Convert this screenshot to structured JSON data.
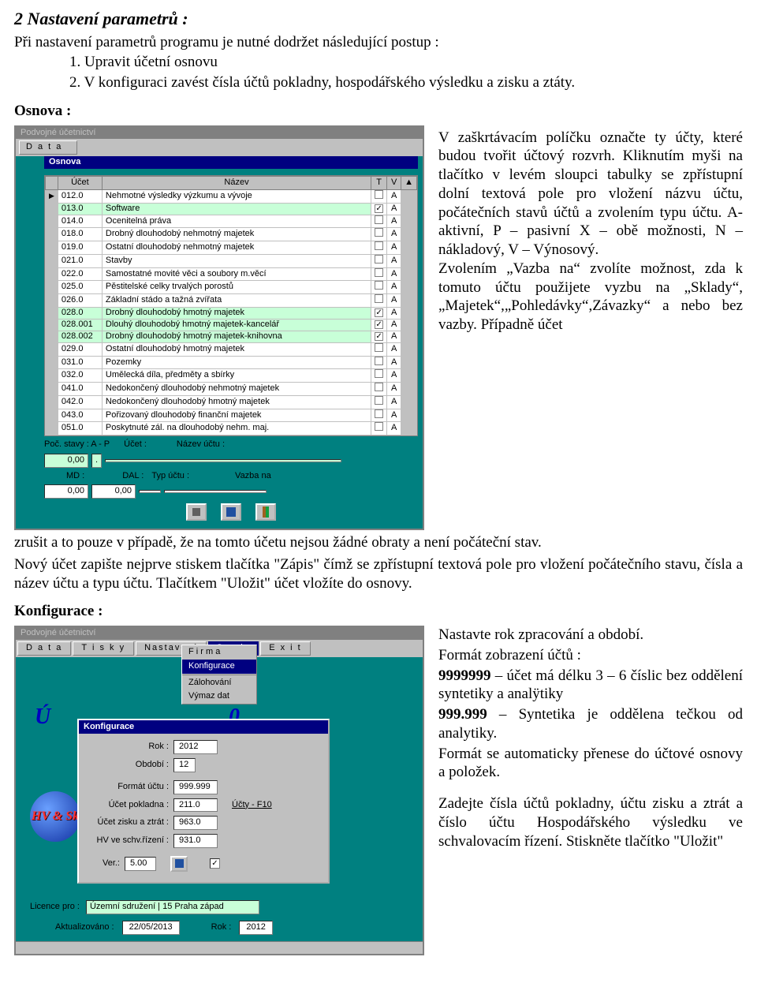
{
  "heading": "2   Nastavení parametrů :",
  "intro": "Při nastavení parametrů programu je nutné dodržet následující postup :",
  "step1": "1.  Upravit účetní osnovu",
  "step2": "2.  V konfiguraci zavést čísla účtů pokladny, hospodářského výsledku a zisku a ztáty.",
  "osnova_label": "Osnova :",
  "osnova_text": "V zaškrtávacím políčku označte ty účty, které budou tvořit účtový rozvrh. Kliknutím myši na tlačítko v levém sloupci tabulky se zpřístupní dolní textová pole pro vložení názvu účtu, počátečních stavů účtů a zvolením typu účtu. A- aktivní, P – pasivní X – obě možnosti, N – nákladový, V – Výnosový.",
  "osnova_text2": "Zvolením „Vazba na“ zvolíte možnost, zda k tomuto účtu použijete vyzbu na „Sklady“, „Majetek“,„Pohledávky“,Závazky“ a nebo bez vazby. Případně účet",
  "after_osnova1": "zrušit a to pouze v případě, že na tomto účetu nejsou žádné obraty a není počáteční stav.",
  "after_osnova2": "Nový účet zapište nejprve stiskem tlačítka \"Zápis\" čímž se zpřístupní textová pole pro vložení počátečního stavu, čísla a název účtu a typu účtu. Tlačítkem \"Uložit\" účet vložíte do osnovy.",
  "konf_label": "Konfigurace :",
  "konf_p1": "Nastavte rok zpracování a období.",
  "konf_p2": "Formát zobrazení účtů :",
  "konf_p3a": "9999999",
  "konf_p3b": " – účet má délku 3 – 6 číslic bez oddělení syntetiky a analÿtiky",
  "konf_p4a": "999.999",
  "konf_p4b": " – Syntetika je oddělena tečkou od analytiky.",
  "konf_p5": "Formát se automaticky přenese do účtové osnovy a položek.",
  "konf_p6": "Zadejte čísla účtů pokladny, účtu zisku a ztrát a číslo účtu Hospodářského výsledku ve schvalovacím řízení. Stiskněte tlačítko \"Uložit\"",
  "app1": {
    "title": "Podvojné účetnictví",
    "menu_data": "D a t a",
    "panel_title": "Osnova",
    "headers": {
      "ucet": "Účet",
      "nazev": "Název",
      "t": "T",
      "v": "V"
    },
    "rows": [
      {
        "u": "012.0",
        "n": "Nehmotné výsledky výzkumu a vývoje",
        "c": false,
        "t": "A",
        "sel": false
      },
      {
        "u": "013.0",
        "n": "Software",
        "c": true,
        "t": "A",
        "sel": true
      },
      {
        "u": "014.0",
        "n": "Ocenitelná práva",
        "c": false,
        "t": "A",
        "sel": false
      },
      {
        "u": "018.0",
        "n": "Drobný dlouhodobý nehmotný majetek",
        "c": false,
        "t": "A",
        "sel": false
      },
      {
        "u": "019.0",
        "n": "Ostatní dlouhodobý nehmotný majetek",
        "c": false,
        "t": "A",
        "sel": false
      },
      {
        "u": "021.0",
        "n": "Stavby",
        "c": false,
        "t": "A",
        "sel": false
      },
      {
        "u": "022.0",
        "n": "Samostatné movité věci a soubory m.věcí",
        "c": false,
        "t": "A",
        "sel": false
      },
      {
        "u": "025.0",
        "n": "Pěstitelské celky trvalých porostů",
        "c": false,
        "t": "A",
        "sel": false
      },
      {
        "u": "026.0",
        "n": "Základní stádo a tažná zvířata",
        "c": false,
        "t": "A",
        "sel": false
      },
      {
        "u": "028.0",
        "n": "Drobný dlouhodobý hmotný majetek",
        "c": true,
        "t": "A",
        "sel": true
      },
      {
        "u": "028.001",
        "n": "Dlouhý dlouhodobý hmotný majetek-kancelář",
        "c": true,
        "t": "A",
        "sel": true
      },
      {
        "u": "028.002",
        "n": "Drobný dlouhodobý hmotný majetek-knihovna",
        "c": true,
        "t": "A",
        "sel": true
      },
      {
        "u": "029.0",
        "n": "Ostatní dlouhodobý hmotný majetek",
        "c": false,
        "t": "A",
        "sel": false
      },
      {
        "u": "031.0",
        "n": "Pozemky",
        "c": false,
        "t": "A",
        "sel": false
      },
      {
        "u": "032.0",
        "n": "Umělecká díla, předměty a sbírky",
        "c": false,
        "t": "A",
        "sel": false
      },
      {
        "u": "041.0",
        "n": "Nedokončený dlouhodobý nehmotný majetek",
        "c": false,
        "t": "A",
        "sel": false
      },
      {
        "u": "042.0",
        "n": "Nedokončený dlouhodobý hmotný majetek",
        "c": false,
        "t": "A",
        "sel": false
      },
      {
        "u": "043.0",
        "n": "Pořizovaný dlouhodobý finanční majetek",
        "c": false,
        "t": "A",
        "sel": false
      },
      {
        "u": "051.0",
        "n": "Poskytnuté zál. na dlouhodobý nehm. maj.",
        "c": false,
        "t": "A",
        "sel": false
      }
    ],
    "lab_poc": "Poč. stavy : A - P",
    "lab_ucet": "Účet :",
    "lab_nazev": "Název účtu :",
    "val_poc": "0,00",
    "lab_md": "MD :",
    "lab_dal": "DAL :",
    "lab_typ": "Typ účtu :",
    "lab_vazba": "Vazba na",
    "val_md": "0,00",
    "val_dal": "0,00"
  },
  "app2": {
    "title": "Podvojné účetnictví",
    "menu": [
      "D a t a",
      "T i s k y",
      "Nastavení",
      "Servis",
      "E x i t"
    ],
    "dropdown": [
      "F i r m a",
      "Konfigurace",
      "Zálohování",
      "Výmaz dat"
    ],
    "big_u": "Ú",
    "big_zero": "0",
    "logo": "HV\n&\nSk",
    "dialog_title": "Konfigurace",
    "rows": {
      "rok_l": "Rok :",
      "rok_v": "2012",
      "obd_l": "Období :",
      "obd_v": "12",
      "fmt_l": "Formát účtu :",
      "fmt_v": "999.999",
      "pok_l": "Účet pokladna :",
      "pok_v": "211.0",
      "ziz_l": "Účet zisku a ztrát :",
      "ziz_v": "963.0",
      "hv_l": "HV ve schv.řízení :",
      "hv_v": "931.0",
      "ver_l": "Ver.:",
      "ver_v": "5.00",
      "ucty_link": "Účty - F10"
    },
    "lic_l": "Licence pro :",
    "lic_v": "Územní sdružení | 15 Praha západ",
    "akt_l": "Aktualizováno :",
    "akt_v": "22/05/2013",
    "rok2_l": "Rok :",
    "rok2_v": "2012"
  }
}
